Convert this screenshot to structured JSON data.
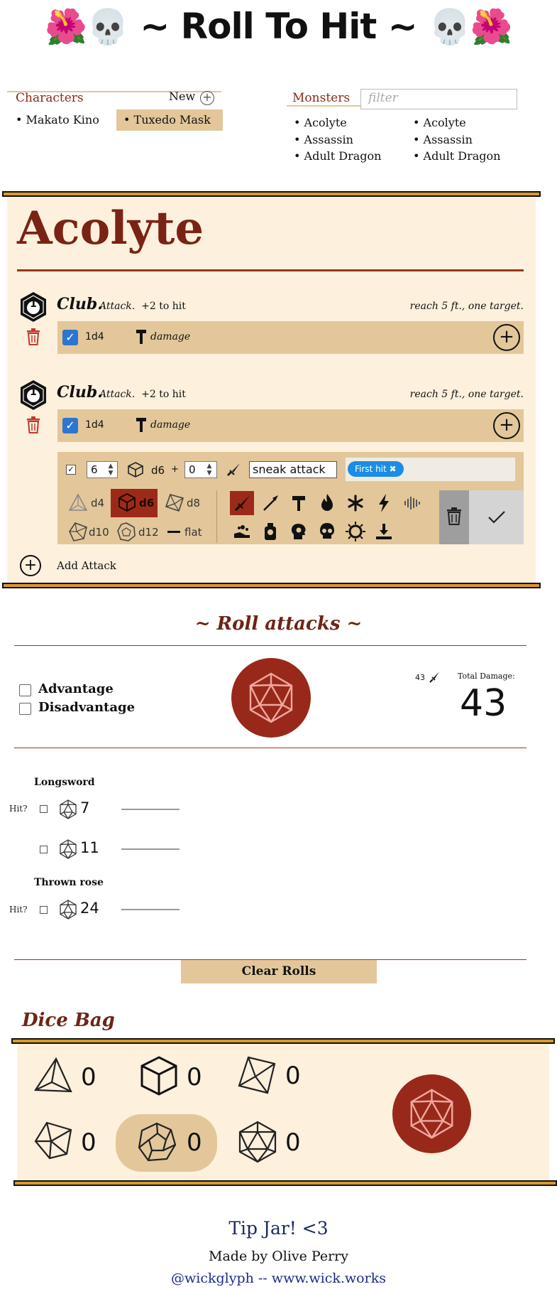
{
  "header": {
    "emoji_left": "🌺💀",
    "title": "~ Roll To Hit ~",
    "emoji_right": "💀🌺"
  },
  "characters": {
    "label": "Characters",
    "new_label": "New",
    "items": [
      "Makato Kino",
      "Tuxedo Mask"
    ],
    "selected": "Tuxedo Mask"
  },
  "monsters": {
    "label": "Monsters",
    "filter_placeholder": "filter",
    "col1": [
      "Acolyte",
      "Assassin",
      "Adult Dragon"
    ],
    "col2": [
      "Acolyte",
      "Assassin",
      "Adult Dragon"
    ]
  },
  "sheet": {
    "name": "Acolyte",
    "attacks": [
      {
        "badge": "1",
        "name": "Club.",
        "type": "Attack.",
        "to_hit": "+2 to hit",
        "reach": "reach 5 ft., one target.",
        "damage_dice": "1d4",
        "damage_label": "damage"
      },
      {
        "badge": "1",
        "name": "Club.",
        "type": "Attack.",
        "to_hit": "+2 to hit",
        "reach": "reach 5 ft., one target.",
        "damage_dice": "1d4",
        "damage_label": "damage"
      }
    ],
    "editor": {
      "count": "6",
      "die": "d6",
      "plus": "+",
      "modifier": "0",
      "name_value": "sneak attack",
      "tag": "First hit",
      "dice_options": [
        "d4",
        "d6",
        "d8",
        "d10",
        "d12",
        "flat"
      ],
      "selected_die": "d6"
    },
    "add_attack_label": "Add Attack"
  },
  "roll": {
    "title": "~ Roll attacks ~",
    "advantage_label": "Advantage",
    "disadvantage_label": "Disadvantage",
    "damage_small": "43",
    "total_label": "Total Damage:",
    "total_value": "43",
    "groups": [
      {
        "name": "Longsword",
        "rolls": [
          {
            "hit_label": "Hit?",
            "value": "7"
          },
          {
            "hit_label": "",
            "value": "11"
          }
        ]
      },
      {
        "name": "Thrown rose",
        "rolls": [
          {
            "hit_label": "Hit?",
            "value": "24"
          }
        ]
      }
    ],
    "clear_label": "Clear Rolls"
  },
  "dice_bag": {
    "title": "Dice Bag",
    "counts": [
      "0",
      "0",
      "0",
      "0",
      "0",
      "0"
    ]
  },
  "footer": {
    "tip": "Tip Jar! <3",
    "made_by": "Made by Olive Perry",
    "links": "@wickglyph -- www.wick.works"
  },
  "colors": {
    "accent": "#98291a",
    "tan": "#e3c79a",
    "sheet_bg": "#fdf0dd",
    "bar": "#d99a2b",
    "blue": "#2a76d2"
  }
}
